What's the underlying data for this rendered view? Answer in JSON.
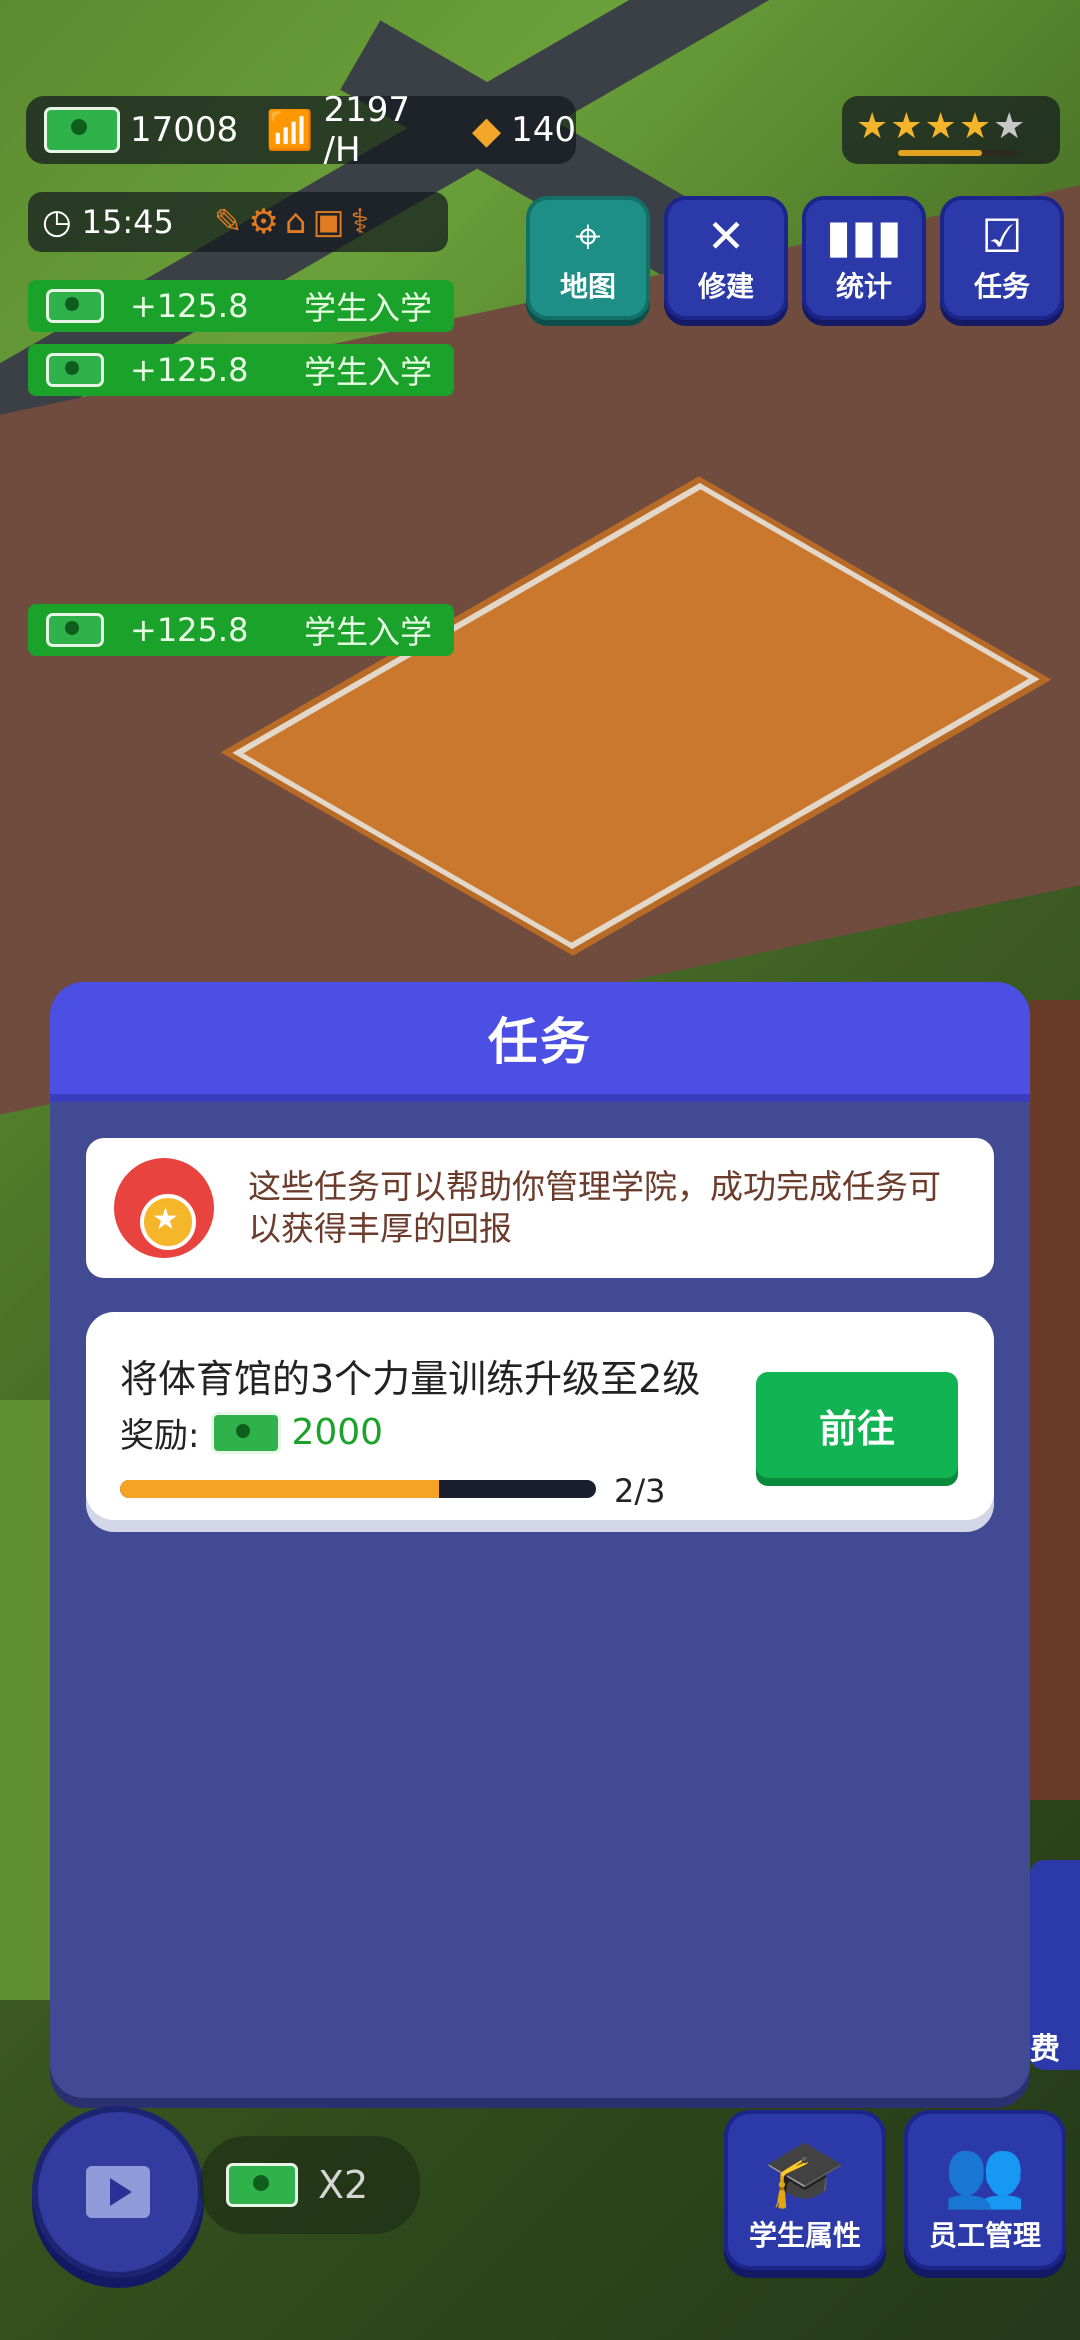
{
  "hud": {
    "money": "17008",
    "income_rate": "2197 /H",
    "gems": "140",
    "stars_filled": 4,
    "stars_total": 5,
    "time": "15:45"
  },
  "nav": [
    {
      "label": "地图",
      "icon": "map-icon",
      "active": true
    },
    {
      "label": "修建",
      "icon": "build-icon",
      "active": false
    },
    {
      "label": "统计",
      "icon": "stats-icon",
      "active": false
    },
    {
      "label": "任务",
      "icon": "task-icon",
      "active": false
    }
  ],
  "income_toasts": [
    {
      "amount": "+125.8",
      "label": "学生入学"
    },
    {
      "amount": "+125.8",
      "label": "学生入学"
    },
    {
      "amount": "+125.8",
      "label": "学生入学"
    }
  ],
  "panel": {
    "title": "任务",
    "info_text": "这些任务可以帮助你管理学院，成功完成任务可以获得丰厚的回报",
    "task": {
      "title": "将体育馆的3个力量训练升级至2级",
      "reward_label": "奖励:",
      "reward_value": "2000",
      "progress_text": "2/3",
      "progress": 0.67,
      "button_label": "前往"
    }
  },
  "bottom": {
    "multiplier_label": "X2",
    "student_button": "学生属性",
    "staff_button": "员工管理",
    "side_partial_label": "费"
  },
  "colors": {
    "panel_bg": "#414a93",
    "panel_header": "#4c4fe3",
    "go_button": "#12b352",
    "progress_fill": "#f5a324",
    "income_toast": "#1aa22a"
  }
}
